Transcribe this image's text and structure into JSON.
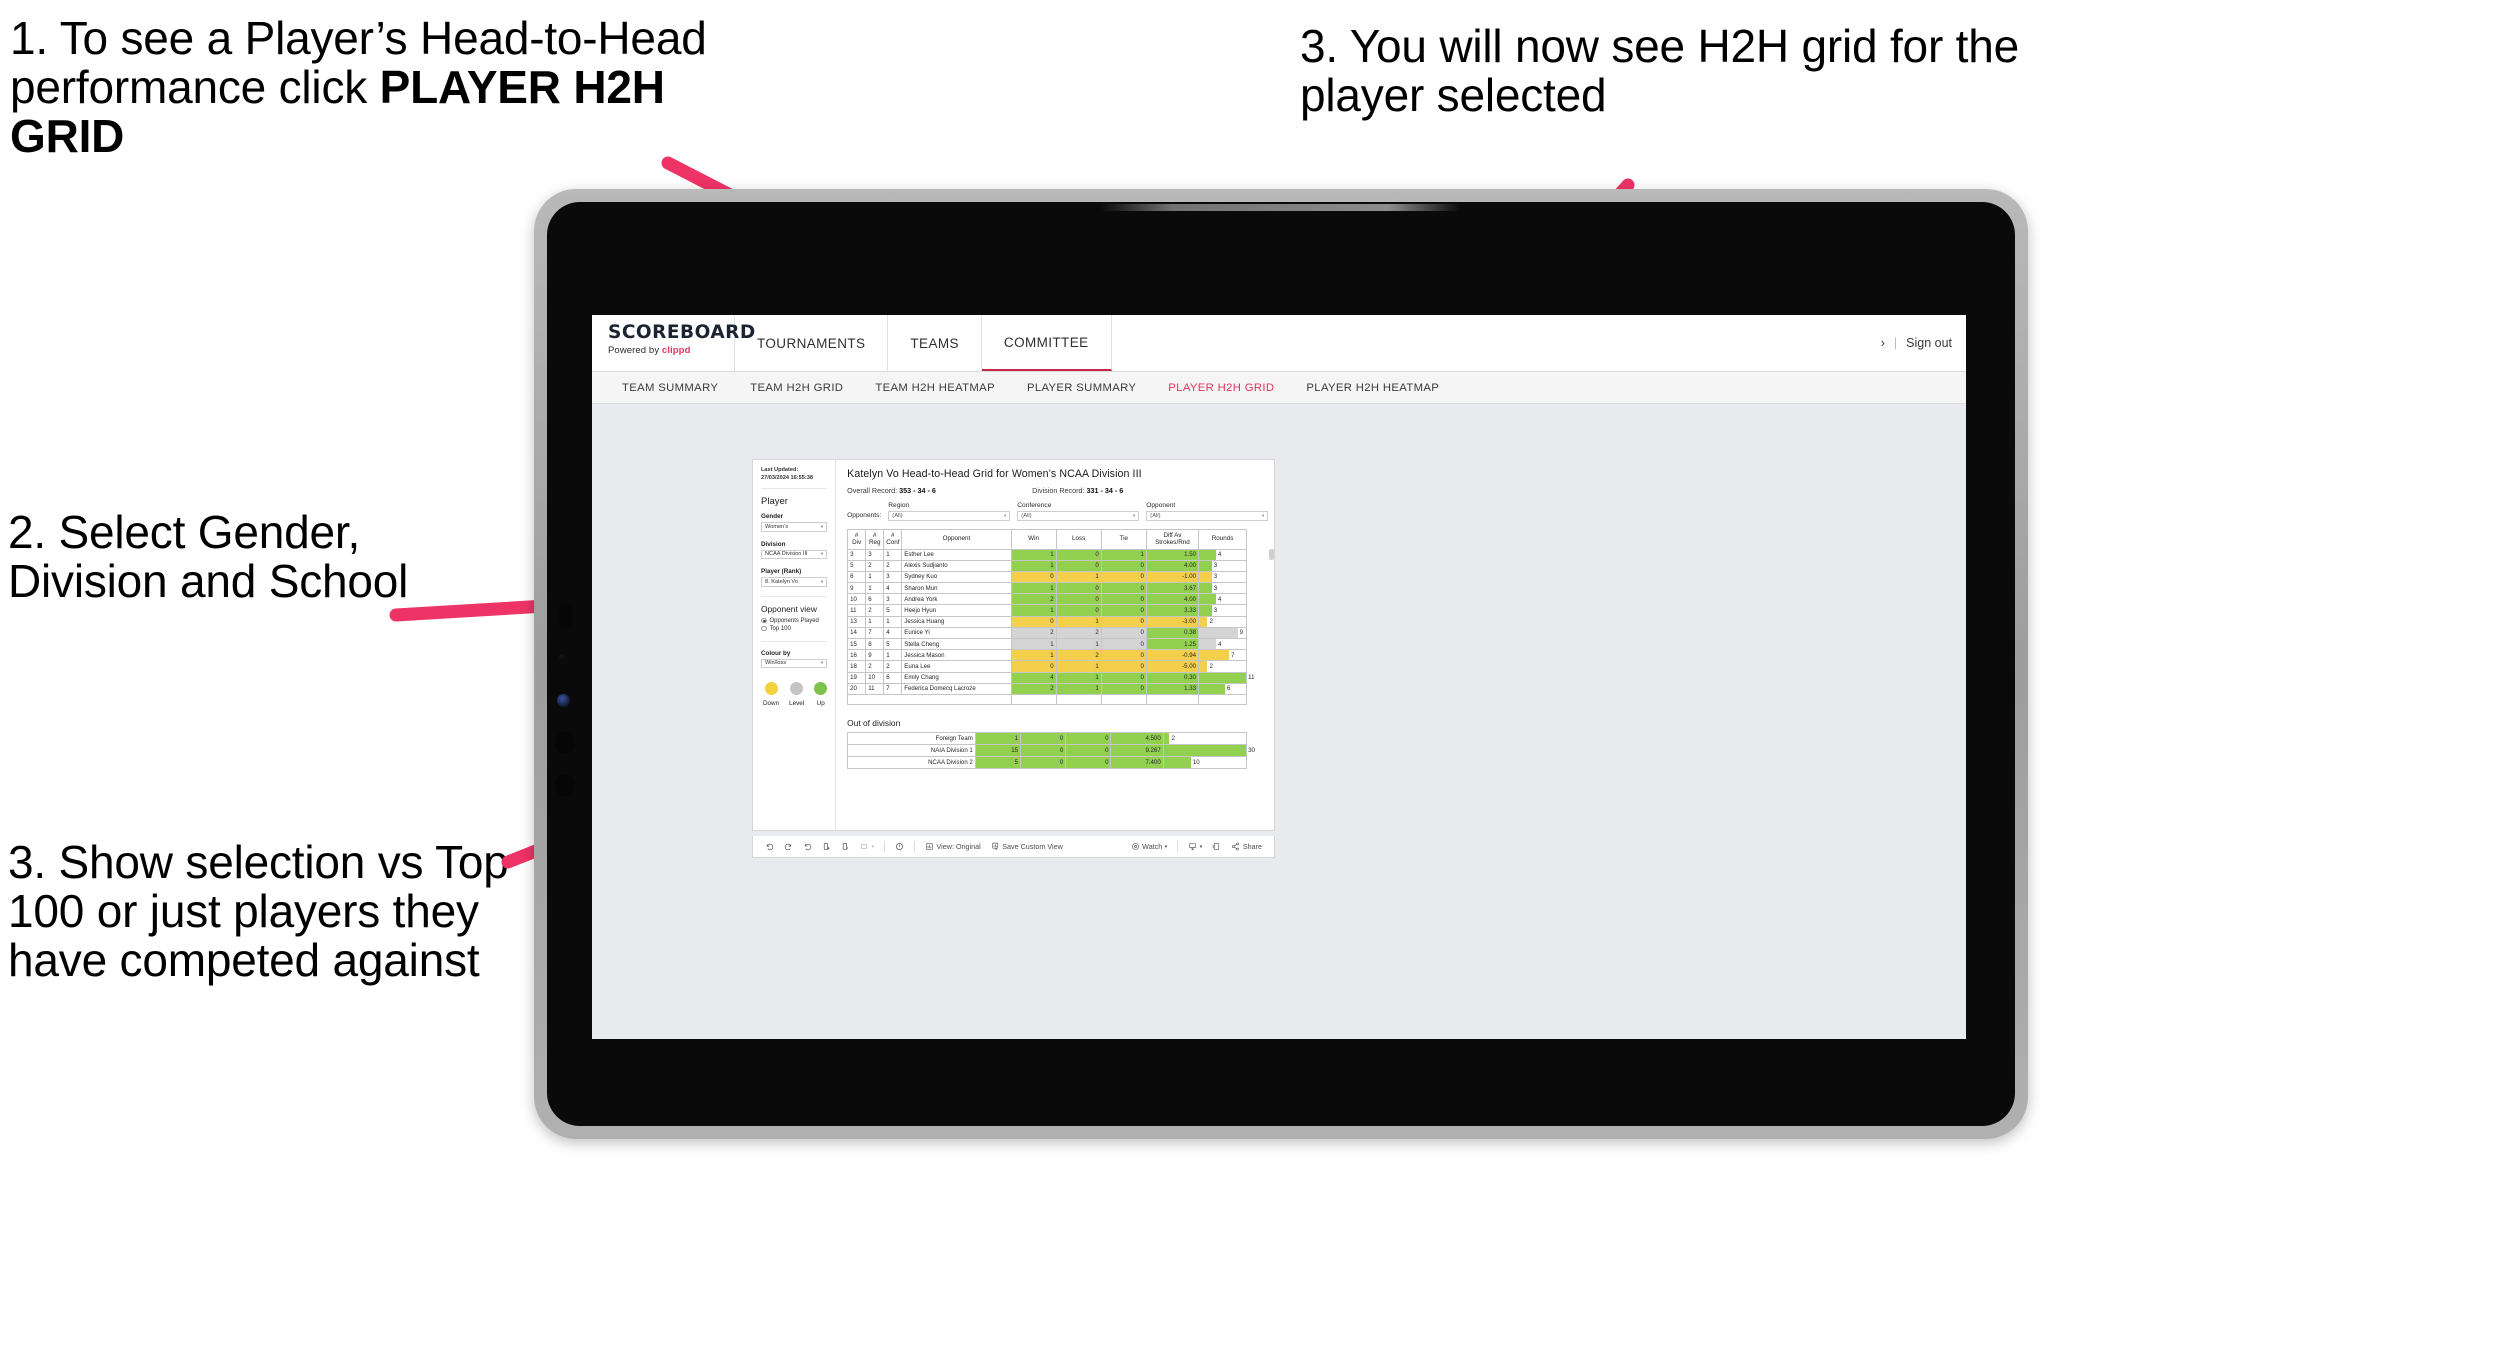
{
  "annotations": {
    "step1": "1. To see a Player’s Head-to-Head performance click ",
    "step1_bold": "PLAYER H2H GRID",
    "step2": "3. You will now see H2H grid for the player selected",
    "step3": "2. Select Gender, Division and School",
    "step4": "3. Show selection vs Top 100 or just players they have competed against",
    "arrow_color": "#ee3366"
  },
  "app": {
    "brand_name": "SCOREBOARD",
    "brand_tagline_prefix": "Powered by ",
    "brand_tagline_name": "clippd",
    "top_nav": [
      {
        "label": "TOURNAMENTS",
        "active": false
      },
      {
        "label": "TEAMS",
        "active": false
      },
      {
        "label": "COMMITTEE",
        "active": true
      }
    ],
    "top_right": {
      "chevron": "›",
      "divider": "|",
      "sign_out": "Sign out"
    },
    "sub_nav": [
      {
        "label": "TEAM SUMMARY",
        "active": false
      },
      {
        "label": "TEAM H2H GRID",
        "active": false
      },
      {
        "label": "TEAM H2H HEATMAP",
        "active": false
      },
      {
        "label": "PLAYER SUMMARY",
        "active": false
      },
      {
        "label": "PLAYER H2H GRID",
        "active": true
      },
      {
        "label": "PLAYER H2H HEATMAP",
        "active": false
      }
    ],
    "accent_color": "#e8315f"
  },
  "pane": {
    "last_updated": "Last Updated: 27/03/2024 16:55:38",
    "section_title": "Player",
    "gender": {
      "label": "Gender",
      "value": "Women’s"
    },
    "division": {
      "label": "Division",
      "value": "NCAA Division III"
    },
    "player": {
      "label": "Player (Rank)",
      "value": "8. Katelyn Vo"
    },
    "opponent_view": {
      "title": "Opponent view",
      "options": [
        {
          "label": "Opponents Played",
          "selected": true
        },
        {
          "label": "Top 100",
          "selected": false
        }
      ]
    },
    "colour_by": {
      "label": "Colour by",
      "value": "Win/loss"
    },
    "legend": [
      {
        "label": "Down",
        "color": "#f3d23c"
      },
      {
        "label": "Level",
        "color": "#c4c4c4"
      },
      {
        "label": "Up",
        "color": "#7ec24b"
      }
    ]
  },
  "view": {
    "title": "Katelyn Vo Head-to-Head Grid for Women’s NCAA Division III",
    "overall_record_label": "Overall Record: ",
    "overall_record_value": "353 - 34 - 6",
    "division_record_label": "Division Record: ",
    "division_record_value": "331 - 34 - 6",
    "opponents_label": "Opponents:",
    "filters": [
      {
        "header": "Region",
        "value": "(All)"
      },
      {
        "header": "Conference",
        "value": "(All)"
      },
      {
        "header": "Opponent",
        "value": "(All)"
      }
    ]
  },
  "chart_data": {
    "type": "table",
    "title": "Katelyn Vo Head-to-Head Grid for Women’s NCAA Division III",
    "columns": [
      "# Div",
      "# Reg",
      "# Conf",
      "Opponent",
      "Win",
      "Loss",
      "Tie",
      "Diff Av Strokes/Rnd",
      "Rounds"
    ],
    "column_headers_multiline": [
      [
        "#",
        "Div"
      ],
      [
        "#",
        "Reg"
      ],
      [
        "#",
        "Conf"
      ],
      [
        "Opponent"
      ],
      [
        "Win"
      ],
      [
        "Loss"
      ],
      [
        "Tie"
      ],
      [
        "Diff Av",
        "Strokes/Rnd"
      ],
      [
        "Rounds"
      ]
    ],
    "rounds_max": 11,
    "rows": [
      {
        "div": "3",
        "reg": "3",
        "conf": "1",
        "opponent": "Esther Lee",
        "win": "1",
        "loss": "0",
        "tie": "1",
        "diff": "1.50",
        "rounds": "4",
        "rounds_val": 4,
        "color": "#92d050"
      },
      {
        "div": "5",
        "reg": "2",
        "conf": "2",
        "opponent": "Alexis Sudjianto",
        "win": "1",
        "loss": "0",
        "tie": "0",
        "diff": "4.00",
        "rounds": "3",
        "rounds_val": 3,
        "color": "#92d050"
      },
      {
        "div": "6",
        "reg": "1",
        "conf": "3",
        "opponent": "Sydney Kuo",
        "win": "0",
        "loss": "1",
        "tie": "0",
        "diff": "-1.00",
        "rounds": "3",
        "rounds_val": 3,
        "color": "#f3cf4c"
      },
      {
        "div": "9",
        "reg": "1",
        "conf": "4",
        "opponent": "Sharon Mun",
        "win": "1",
        "loss": "0",
        "tie": "0",
        "diff": "3.67",
        "rounds": "3",
        "rounds_val": 3,
        "color": "#92d050"
      },
      {
        "div": "10",
        "reg": "6",
        "conf": "3",
        "opponent": "Andrea York",
        "win": "2",
        "loss": "0",
        "tie": "0",
        "diff": "4.00",
        "rounds": "4",
        "rounds_val": 4,
        "color": "#92d050"
      },
      {
        "div": "11",
        "reg": "2",
        "conf": "5",
        "opponent": "Heejo Hyun",
        "win": "1",
        "loss": "0",
        "tie": "0",
        "diff": "3.33",
        "rounds": "3",
        "rounds_val": 3,
        "color": "#92d050"
      },
      {
        "div": "13",
        "reg": "1",
        "conf": "1",
        "opponent": "Jessica Huang",
        "win": "0",
        "loss": "1",
        "tie": "0",
        "diff": "-3.00",
        "rounds": "2",
        "rounds_val": 2,
        "color": "#f3cf4c"
      },
      {
        "div": "14",
        "reg": "7",
        "conf": "4",
        "opponent": "Eunice Yi",
        "win": "2",
        "loss": "2",
        "tie": "0",
        "diff": "0.38",
        "rounds": "9",
        "rounds_val": 9,
        "color": "#d4d4d4",
        "diff_color": "#92d050"
      },
      {
        "div": "15",
        "reg": "8",
        "conf": "5",
        "opponent": "Stella Cheng",
        "win": "1",
        "loss": "1",
        "tie": "0",
        "diff": "1.25",
        "rounds": "4",
        "rounds_val": 4,
        "color": "#d4d4d4",
        "diff_color": "#92d050"
      },
      {
        "div": "16",
        "reg": "9",
        "conf": "1",
        "opponent": "Jessica Mason",
        "win": "1",
        "loss": "2",
        "tie": "0",
        "diff": "-0.94",
        "rounds": "7",
        "rounds_val": 7,
        "color": "#f3cf4c"
      },
      {
        "div": "18",
        "reg": "2",
        "conf": "2",
        "opponent": "Euna Lee",
        "win": "0",
        "loss": "1",
        "tie": "0",
        "diff": "-5.00",
        "rounds": "2",
        "rounds_val": 2,
        "color": "#f3cf4c"
      },
      {
        "div": "19",
        "reg": "10",
        "conf": "6",
        "opponent": "Emily Chang",
        "win": "4",
        "loss": "1",
        "tie": "0",
        "diff": "0.30",
        "rounds": "11",
        "rounds_val": 11,
        "color": "#92d050"
      },
      {
        "div": "20",
        "reg": "11",
        "conf": "7",
        "opponent": "Federica Domecq Lacroze",
        "win": "2",
        "loss": "1",
        "tie": "0",
        "diff": "1.33",
        "rounds": "6",
        "rounds_val": 6,
        "color": "#92d050"
      }
    ]
  },
  "out_of_division": {
    "title": "Out of division",
    "rounds_max": 30,
    "rows": [
      {
        "name": "Foreign Team",
        "win": "1",
        "loss": "0",
        "tie": "0",
        "diff": "4.500",
        "rounds": "2",
        "rounds_val": 2,
        "color": "#92d050"
      },
      {
        "name": "NAIA Division 1",
        "win": "15",
        "loss": "0",
        "tie": "0",
        "diff": "9.267",
        "rounds": "30",
        "rounds_val": 30,
        "color": "#92d050"
      },
      {
        "name": "NCAA Division 2",
        "win": "5",
        "loss": "0",
        "tie": "0",
        "diff": "7.400",
        "rounds": "10",
        "rounds_val": 10,
        "color": "#92d050"
      }
    ]
  },
  "toolbar": {
    "undo": "undo-icon",
    "redo": "redo-icon",
    "revert": "revert-icon",
    "refresh": "refresh-data-icon",
    "pause": "pause-updates-icon",
    "view_alerts": "alerts-icon",
    "view_original_label": "View: Original",
    "save_custom_view_label": "Save Custom View",
    "watch_label": "Watch",
    "download_label": "download-icon",
    "fullscreen_label": "fullscreen-icon",
    "share_label": "Share"
  }
}
